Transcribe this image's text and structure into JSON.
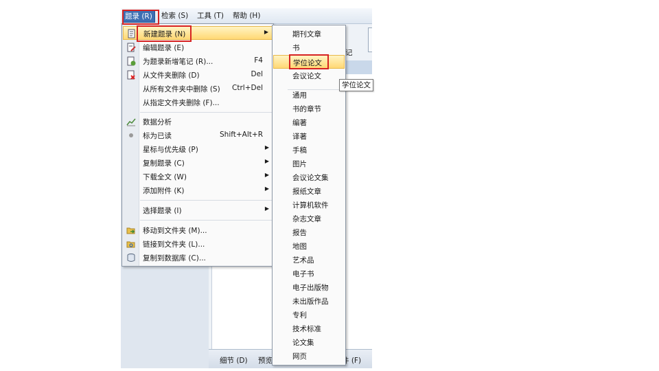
{
  "menubar": {
    "entries": "题录 (R)",
    "search": "检索 (S)",
    "tools": "工具 (T)",
    "help": "帮助 (H)"
  },
  "background": {
    "tab_partial": "记",
    "bottom_tabs": [
      "细节 (D)",
      "预览",
      "件 (F)"
    ]
  },
  "menu": {
    "items": [
      {
        "label": "新建题录 (N)",
        "shortcut": "",
        "submenu": true,
        "icon": "new-entry-icon"
      },
      {
        "label": "编辑题录 (E)",
        "shortcut": "",
        "submenu": false,
        "icon": "edit-entry-icon"
      },
      {
        "label": "为题录新增笔记 (R)...",
        "shortcut": "F4",
        "submenu": false,
        "icon": "add-note-icon"
      },
      {
        "label": "从文件夹删除 (D)",
        "shortcut": "Del",
        "submenu": false,
        "icon": "delete-icon"
      },
      {
        "label": "从所有文件夹中删除 (S)",
        "shortcut": "Ctrl+Del",
        "submenu": false,
        "icon": ""
      },
      {
        "label": "从指定文件夹删除 (F)...",
        "shortcut": "",
        "submenu": false,
        "icon": ""
      },
      {
        "label": "数据分析",
        "shortcut": "",
        "submenu": false,
        "icon": "data-analysis-icon"
      },
      {
        "label": "标为已读",
        "shortcut": "Shift+Alt+R",
        "submenu": false,
        "icon": "read-dot-icon"
      },
      {
        "label": "星标与优先级 (P)",
        "shortcut": "",
        "submenu": true,
        "icon": ""
      },
      {
        "label": "复制题录 (C)",
        "shortcut": "",
        "submenu": true,
        "icon": ""
      },
      {
        "label": "下载全文 (W)",
        "shortcut": "",
        "submenu": true,
        "icon": ""
      },
      {
        "label": "添加附件 (K)",
        "shortcut": "",
        "submenu": true,
        "icon": ""
      },
      {
        "label": "选择题录 (I)",
        "shortcut": "",
        "submenu": true,
        "icon": ""
      },
      {
        "label": "移动到文件夹 (M)...",
        "shortcut": "",
        "submenu": false,
        "icon": "move-folder-icon"
      },
      {
        "label": "链接到文件夹 (L)...",
        "shortcut": "",
        "submenu": false,
        "icon": "link-folder-icon"
      },
      {
        "label": "复制到数据库 (C)...",
        "shortcut": "",
        "submenu": false,
        "icon": "copy-database-icon"
      }
    ]
  },
  "submenu": {
    "items": [
      "期刊文章",
      "书",
      "学位论文",
      "会议论文",
      "通用",
      "书的章节",
      "编著",
      "译著",
      "手稿",
      "图片",
      "会议论文集",
      "报纸文章",
      "计算机软件",
      "杂志文章",
      "报告",
      "地图",
      "艺术品",
      "电子书",
      "电子出版物",
      "未出版作品",
      "专利",
      "技术标准",
      "论文集",
      "网页"
    ],
    "highlighted": "学位论文"
  },
  "tooltip": "学位论文",
  "colors": {
    "highlight": "#ffd874",
    "annotation_box": "#d62222",
    "menubar_active": "#3d6fb3"
  }
}
